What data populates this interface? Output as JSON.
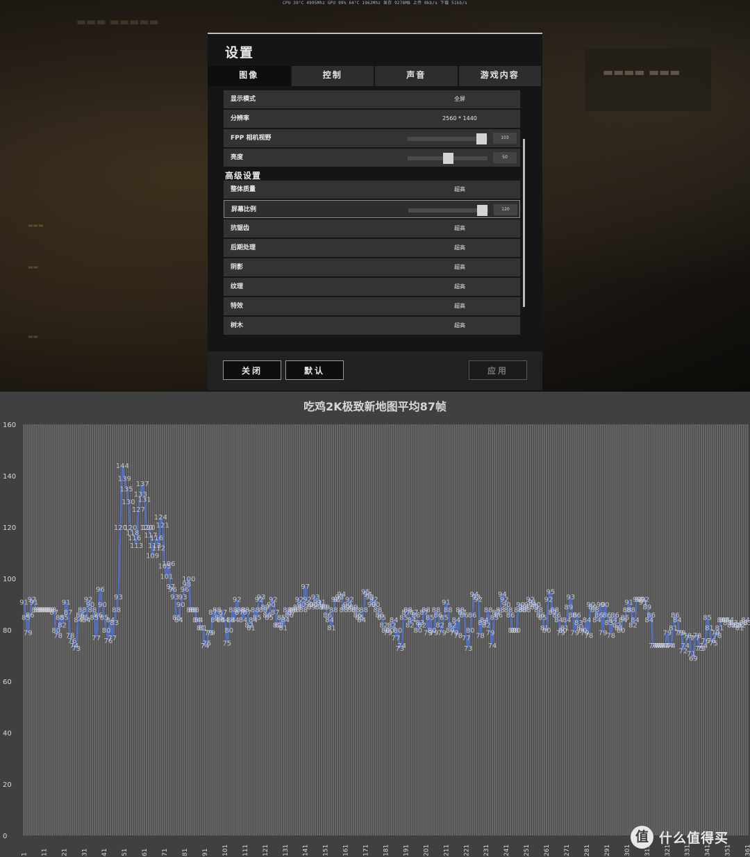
{
  "hud": "CPU 39°C 4995Mhz  GPU 99% 64°C 1962Mhz 显存 9278MB  上传 0kb/s  下载 51kb/s",
  "settings": {
    "title": "设置",
    "tabs": [
      "图像",
      "控制",
      "声音",
      "游戏内容"
    ],
    "rows": [
      {
        "label": "显示模式",
        "value": "全屏"
      },
      {
        "label": "分辨率",
        "value": "2560 * 1440"
      },
      {
        "label": "FPP 相机视野",
        "slider": 0.92,
        "value": "103"
      },
      {
        "label": "亮度",
        "slider": 0.5,
        "value": "50"
      },
      {
        "section": "高级设置"
      },
      {
        "label": "整体质量",
        "value": "超高"
      },
      {
        "label": "屏幕比例",
        "slider": 0.92,
        "value": "120"
      },
      {
        "label": "抗锯齿",
        "value": "超高"
      },
      {
        "label": "后期处理",
        "value": "超高"
      },
      {
        "label": "阴影",
        "value": "超高"
      },
      {
        "label": "纹理",
        "value": "超高"
      },
      {
        "label": "特效",
        "value": "超高"
      },
      {
        "label": "树木",
        "value": "超高"
      }
    ],
    "buttons": {
      "close": "关闭",
      "default": "默认",
      "apply": "应用"
    }
  },
  "colors": {
    "line": "#4a6fd6",
    "bar": "#8a8a8a",
    "chart_bg": "#404040",
    "label": "#d8d8d8"
  },
  "chart_data": {
    "type": "line",
    "title": "吃鸡2K极致新地图平均87帧",
    "ylim": [
      0,
      160
    ],
    "yticks": [
      0,
      20,
      40,
      60,
      80,
      100,
      120,
      140,
      160
    ],
    "x_start": 1,
    "x_tick_step": 10,
    "y_values": [
      91,
      85,
      79,
      86,
      92,
      91,
      88,
      88,
      88,
      88,
      88,
      88,
      88,
      88,
      88,
      87,
      80,
      78,
      85,
      82,
      85,
      91,
      87,
      78,
      76,
      74,
      73,
      84,
      86,
      88,
      85,
      84,
      92,
      90,
      88,
      85,
      77,
      86,
      96,
      90,
      85,
      80,
      76,
      84,
      77,
      83,
      88,
      93,
      120,
      144,
      139,
      135,
      130,
      120,
      118,
      116,
      113,
      127,
      133,
      137,
      131,
      120,
      120,
      117,
      109,
      113,
      116,
      112,
      124,
      121,
      105,
      101,
      106,
      97,
      96,
      93,
      85,
      84,
      90,
      93,
      96,
      98,
      100,
      88,
      88,
      88,
      84,
      84,
      81,
      81,
      74,
      75,
      79,
      79,
      87,
      84,
      88,
      85,
      84,
      87,
      84,
      75,
      80,
      84,
      88,
      84,
      92,
      87,
      88,
      84,
      88,
      87,
      82,
      81,
      84,
      88,
      85,
      92,
      93,
      88,
      89,
      86,
      85,
      90,
      92,
      87,
      82,
      82,
      85,
      81,
      84,
      88,
      86,
      87,
      88,
      88,
      89,
      92,
      90,
      88,
      97,
      92,
      90,
      89,
      90,
      93,
      91,
      89,
      91,
      89,
      89,
      86,
      84,
      81,
      88,
      92,
      92,
      93,
      94,
      88,
      89,
      90,
      92,
      88,
      89,
      88,
      86,
      85,
      84,
      88,
      95,
      94,
      93,
      90,
      92,
      90,
      88,
      86,
      85,
      82,
      80,
      79,
      80,
      82,
      84,
      77,
      80,
      73,
      74,
      85,
      87,
      88,
      82,
      84,
      87,
      86,
      80,
      83,
      82,
      87,
      88,
      79,
      85,
      80,
      79,
      88,
      86,
      82,
      79,
      85,
      91,
      88,
      80,
      82,
      79,
      84,
      78,
      88,
      87,
      86,
      77,
      73,
      80,
      86,
      94,
      93,
      92,
      78,
      83,
      84,
      82,
      88,
      79,
      74,
      85,
      87,
      86,
      88,
      94,
      92,
      90,
      88,
      86,
      80,
      80,
      80,
      88,
      90,
      88,
      89,
      88,
      90,
      92,
      91,
      89,
      90,
      88,
      86,
      85,
      81,
      80,
      92,
      95,
      87,
      88,
      86,
      84,
      79,
      80,
      81,
      84,
      89,
      93,
      86,
      79,
      86,
      83,
      81,
      80,
      79,
      84,
      78,
      90,
      89,
      88,
      84,
      86,
      90,
      79,
      90,
      86,
      83,
      78,
      84,
      86,
      82,
      81,
      80,
      84,
      85,
      88,
      91,
      88,
      82,
      84,
      92,
      92,
      92,
      91,
      92,
      89,
      84,
      86,
      74,
      74,
      74,
      74,
      74,
      74,
      74,
      79,
      74,
      74,
      81,
      86,
      84,
      79,
      79,
      72,
      74,
      78,
      77,
      71,
      69,
      77,
      78,
      73,
      73,
      74,
      76,
      85,
      81,
      76,
      75,
      79,
      78,
      81,
      84,
      84,
      84,
      83,
      84,
      82,
      83,
      82,
      82,
      81,
      82,
      83,
      84,
      83
    ]
  }
}
